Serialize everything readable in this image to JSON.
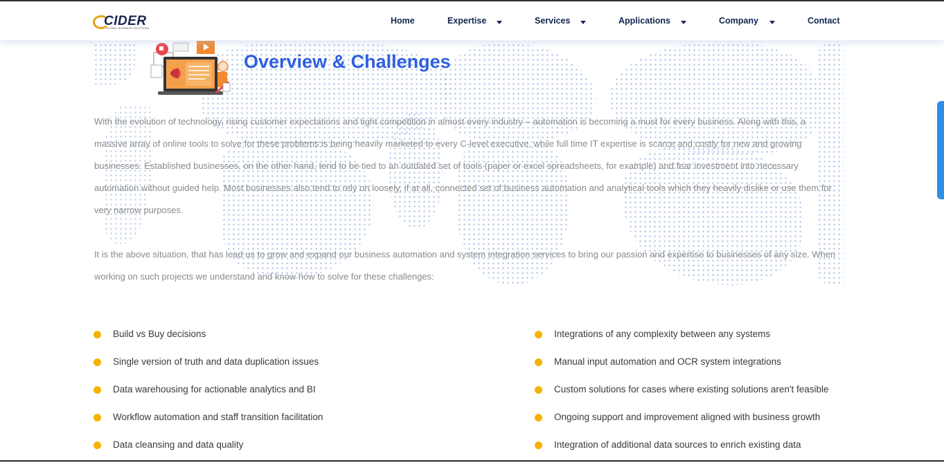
{
  "brand": {
    "logo_text": "CIDER",
    "logo_subtitle": "GLOBAL BUSINESS SOLUTIONS"
  },
  "nav": {
    "home": "Home",
    "expertise": "Expertise",
    "services": "Services",
    "applications": "Applications",
    "company": "Company",
    "contact": "Contact"
  },
  "main": {
    "title": "Overview & Challenges",
    "paragraph1": "With the evolution of technology, rising customer expectations and tight competition in almost every industry – automation is becoming a must for every business. Along with this, a massive array of online tools to solve for these problems is being heavily marketed to every C-level executive, while full time IT expertise is scarce and costly for new and growing businesses. Established businesses, on the other hand, tend to be tied to an outdated set of tools (paper or excel spreadsheets, for example) and fear investment into necessary automation without guided help. Most businesses also tend to rely on loosely, if at all, connected set of business automation and analytical tools which they heavily dislike or use them for very narrow purposes.",
    "paragraph2": "It is the above situation, that has lead us to grow and expand our business automation and system integration services to bring our passion and expertise to businesses of any size. When working on such projects we understand and know how to solve for these challenges:",
    "bullets_left": [
      "Build vs Buy decisions",
      "Single version of truth and data duplication issues",
      "Data warehousing for actionable analytics and BI",
      "Workflow automation and staff transition facilitation",
      "Data cleansing and data quality"
    ],
    "bullets_right": [
      "Integrations of any complexity between any systems",
      "Manual input automation and OCR system integrations",
      "Custom solutions for cases where existing solutions aren't feasible",
      "Ongoing support and improvement aligned with business growth",
      "Integration of additional data sources to enrich existing data"
    ]
  },
  "colors": {
    "brand_navy": "#14254f",
    "title_blue": "#2f5fe0",
    "bullet_yellow": "#f5b300",
    "body_text": "#8a8a8a"
  },
  "icons": [
    "caret-down-icon",
    "bullet-dot-icon",
    "laptop-illustration"
  ]
}
